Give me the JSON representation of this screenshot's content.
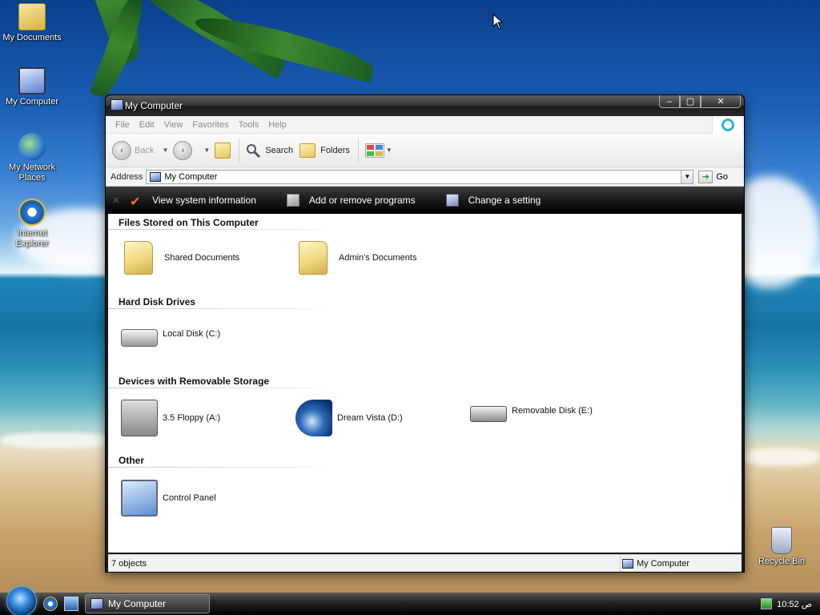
{
  "desktop": {
    "icons": [
      {
        "label": "My Documents",
        "icon": "documents-folder-icon"
      },
      {
        "label": "My Computer",
        "icon": "computer-icon"
      },
      {
        "label": "My Network Places",
        "icon": "network-places-icon"
      },
      {
        "label": "Internet Explorer",
        "icon": "internet-explorer-icon"
      },
      {
        "label": "Recycle Bin",
        "icon": "recycle-bin-icon"
      }
    ]
  },
  "window": {
    "title": "My Computer",
    "controls": {
      "minimize": "‒",
      "maximize": "▢",
      "close": "✕"
    },
    "menu": [
      "File",
      "Edit",
      "View",
      "Favorites",
      "Tools",
      "Help"
    ],
    "toolbar": {
      "back": "Back",
      "search": "Search",
      "folders": "Folders"
    },
    "address": {
      "label": "Address",
      "value": "My Computer",
      "go": "Go"
    },
    "tasks": [
      {
        "label": "View system information",
        "icon": "checkmark-icon"
      },
      {
        "label": "Add or remove programs",
        "icon": "programs-icon"
      },
      {
        "label": "Change a setting",
        "icon": "settings-icon"
      }
    ],
    "groups": [
      {
        "header": "Files Stored on This Computer",
        "items": [
          {
            "label": "Shared Documents",
            "icon": "folder-icon"
          },
          {
            "label": "Admin's Documents",
            "icon": "folder-icon"
          }
        ]
      },
      {
        "header": "Hard Disk Drives",
        "items": [
          {
            "label": "Local Disk (C:)",
            "icon": "hard-disk-icon"
          }
        ]
      },
      {
        "header": "Devices with Removable Storage",
        "items": [
          {
            "label": "3.5 Floppy (A:)",
            "icon": "floppy-drive-icon"
          },
          {
            "label": "Dream Vista (D:)",
            "icon": "cd-drive-icon"
          },
          {
            "label": "Removable Disk (E:)",
            "icon": "removable-disk-icon"
          }
        ]
      },
      {
        "header": "Other",
        "items": [
          {
            "label": "Control Panel",
            "icon": "control-panel-icon"
          }
        ]
      }
    ],
    "status": {
      "objects": "7 objects",
      "location": "My Computer"
    }
  },
  "taskbar": {
    "window_button": "My Computer",
    "clock": "10:52 ص"
  },
  "colors": {
    "title_bar": "#2a2a2a",
    "task_strip": "#1a1a1a",
    "content_bg": "#ffffff",
    "task_check": "#f07a2a"
  }
}
